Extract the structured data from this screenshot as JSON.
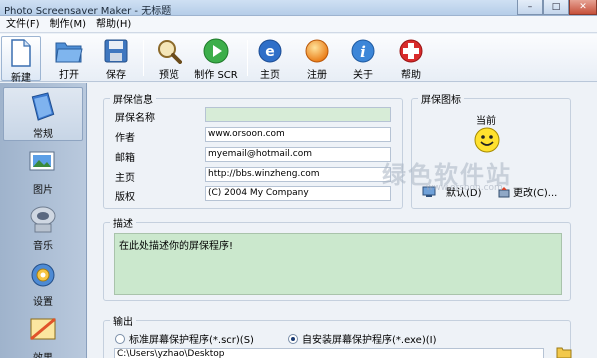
{
  "window": {
    "title": "Photo Screensaver Maker - 无标题"
  },
  "menu": {
    "items": [
      "文件(F)",
      "制作(M)",
      "帮助(H)"
    ]
  },
  "toolbar": {
    "items": [
      {
        "label": "新建",
        "icon": "new-document-icon"
      },
      {
        "label": "打开",
        "icon": "open-folder-icon"
      },
      {
        "label": "保存",
        "icon": "save-disk-icon"
      },
      {
        "label": "预览",
        "icon": "magnifier-icon"
      },
      {
        "label": "制作 SCR",
        "icon": "play-icon"
      },
      {
        "label": "主页",
        "icon": "ie-globe-icon"
      },
      {
        "label": "注册",
        "icon": "orange-orb-icon"
      },
      {
        "label": "关于",
        "icon": "info-icon"
      },
      {
        "label": "帮助",
        "icon": "help-cross-icon"
      }
    ]
  },
  "sidebar": {
    "items": [
      {
        "label": "常规",
        "icon": "book-icon"
      },
      {
        "label": "图片",
        "icon": "pictures-icon"
      },
      {
        "label": "音乐",
        "icon": "speaker-icon"
      },
      {
        "label": "设置",
        "icon": "settings-gear-icon"
      },
      {
        "label": "效果",
        "icon": "effects-icon"
      }
    ]
  },
  "info": {
    "legend": "屏保信息",
    "name_label": "屏保名称",
    "name_value": "",
    "author_label": "作者",
    "author_value": "www.orsoon.com",
    "email_label": "邮箱",
    "email_value": "myemail@hotmail.com",
    "home_label": "主页",
    "home_value": "http://bbs.winzheng.com",
    "copyright_label": "版权",
    "copyright_value": "(C) 2004 My Company"
  },
  "icon_panel": {
    "legend": "屏保图标",
    "current_label": "当前",
    "default_button": "默认(D)",
    "change_button": "更改(C)..."
  },
  "description": {
    "legend": "描述",
    "text": "在此处描述你的屏保程序!"
  },
  "output": {
    "legend": "输出",
    "option_scr": "标准屏幕保护程序(*.scr)(S)",
    "option_exe": "自安装屏幕保护程序(*.exe)(I)",
    "selected": "exe",
    "path": "C:\\Users\\yzhao\\Desktop"
  },
  "watermark": {
    "text": "绿色软件站",
    "sub": "www.orsoon.com"
  },
  "colors": {
    "accent_green": "#cbe8cd",
    "title_bar": "#cfe0f3",
    "sidebar": "#a9bdd4"
  }
}
